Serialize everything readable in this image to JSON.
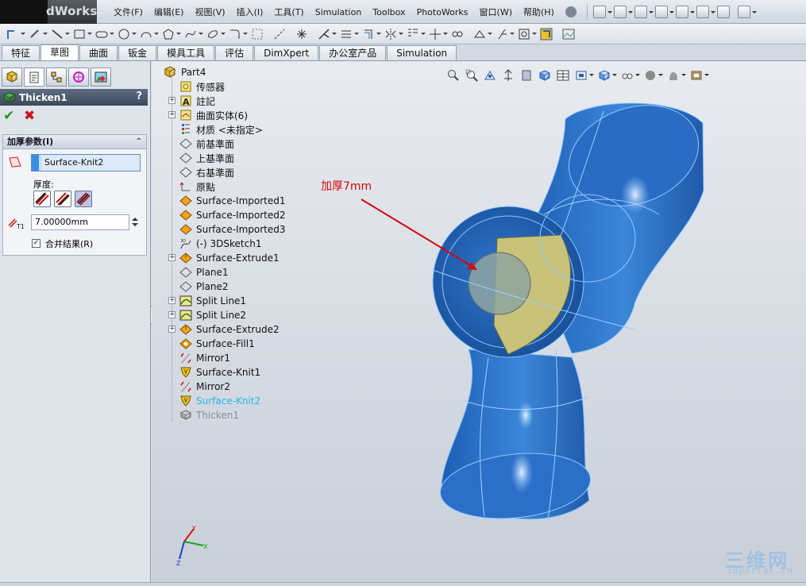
{
  "app": {
    "logo_text": "dWorks"
  },
  "menu": [
    "文件(F)",
    "编辑(E)",
    "视图(V)",
    "插入(I)",
    "工具(T)",
    "Simulation",
    "Toolbox",
    "PhotoWorks",
    "窗口(W)",
    "帮助(H)"
  ],
  "command_tabs": [
    "特征",
    "草图",
    "曲面",
    "钣金",
    "模具工具",
    "评估",
    "DimXpert",
    "办公室产品",
    "Simulation"
  ],
  "active_tab": "草图",
  "property_manager": {
    "title": "Thicken1",
    "help": "?",
    "ok_symbol": "✔",
    "cancel_symbol": "✖",
    "group_title": "加厚参数(I)",
    "collapse_symbol": "⌃",
    "face_selection": "Surface-Knit2",
    "thickness_label": "厚度:",
    "thickness_value": "7.00000mm",
    "merge_label": "合并结果(R)",
    "merge_checked": "✓"
  },
  "feature_tree": {
    "root": "Part4",
    "items": [
      {
        "label": "传感器",
        "icon": "sensor-icon"
      },
      {
        "label": "註記",
        "icon": "annotations-icon",
        "expandable": true
      },
      {
        "label": "曲面实体(6)",
        "icon": "surface-bodies-icon",
        "expandable": true
      },
      {
        "label": "材质 <未指定>",
        "icon": "material-icon"
      },
      {
        "label": "前基準面",
        "icon": "plane-icon"
      },
      {
        "label": "上基準面",
        "icon": "plane-icon"
      },
      {
        "label": "右基準面",
        "icon": "plane-icon"
      },
      {
        "label": "原點",
        "icon": "origin-icon"
      },
      {
        "label": "Surface-Imported1",
        "icon": "surface-imported-icon"
      },
      {
        "label": "Surface-Imported2",
        "icon": "surface-imported-icon"
      },
      {
        "label": "Surface-Imported3",
        "icon": "surface-imported-icon"
      },
      {
        "label": "(-) 3DSketch1",
        "icon": "3dsketch-icon"
      },
      {
        "label": "Surface-Extrude1",
        "icon": "surface-extrude-icon",
        "expandable": true
      },
      {
        "label": "Plane1",
        "icon": "plane-icon"
      },
      {
        "label": "Plane2",
        "icon": "plane-icon"
      },
      {
        "label": "Split Line1",
        "icon": "split-line-icon",
        "expandable": true
      },
      {
        "label": "Split Line2",
        "icon": "split-line-icon",
        "expandable": true
      },
      {
        "label": "Surface-Extrude2",
        "icon": "surface-extrude-icon",
        "expandable": true
      },
      {
        "label": "Surface-Fill1",
        "icon": "surface-fill-icon"
      },
      {
        "label": "Mirror1",
        "icon": "mirror-icon"
      },
      {
        "label": "Surface-Knit1",
        "icon": "surface-knit-icon"
      },
      {
        "label": "Mirror2",
        "icon": "mirror-icon"
      },
      {
        "label": "Surface-Knit2",
        "icon": "surface-knit-icon",
        "state": "selected"
      },
      {
        "label": "Thicken1",
        "icon": "thicken-icon",
        "state": "suppressed"
      }
    ]
  },
  "viewport": {
    "annotation": "加厚7mm",
    "triad_axes": [
      "Y",
      "Z",
      "X"
    ]
  },
  "watermark": {
    "main": "三维网",
    "sub": "3dportal.cn"
  },
  "colors": {
    "part_blue": "#2f74c8",
    "part_edge": "#8fc6ff",
    "inner_yellow": "#c9c27a",
    "annotation_red": "#d20a0a",
    "selected_text": "#22b8ee"
  }
}
